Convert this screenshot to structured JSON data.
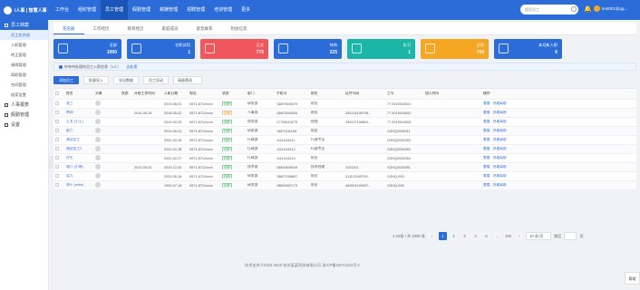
{
  "topbar": {
    "logo_text": "i人事 | 智慧人事",
    "nav": [
      {
        "label": "工作台"
      },
      {
        "label": "组织管理"
      },
      {
        "label": "员工管理"
      },
      {
        "label": "假勤管理"
      },
      {
        "label": "薪酬管理"
      },
      {
        "label": "招聘管理"
      },
      {
        "label": "培训管理"
      },
      {
        "label": "更多"
      }
    ],
    "active_nav": 2,
    "search_placeholder": "搜索员工",
    "username": "test001@qq..."
  },
  "sidebar": {
    "groups": [
      {
        "label": "员工档案",
        "active": true,
        "items": [
          {
            "label": "员工花名册",
            "active": true
          },
          {
            "label": "入职管理"
          },
          {
            "label": "转正管理"
          },
          {
            "label": "调岗管理"
          },
          {
            "label": "离职管理"
          },
          {
            "label": "合同管理"
          },
          {
            "label": "档案设置"
          }
        ]
      },
      {
        "label": "人事报表"
      },
      {
        "label": "假勤管理"
      },
      {
        "label": "设置"
      }
    ]
  },
  "tabs": [
    "花名册",
    "工作经历",
    "教育经历",
    "家庭成员",
    "紧急联系",
    "附加信息"
  ],
  "cards": [
    {
      "label": "全部",
      "value": "1000",
      "color": "#2b6cd8"
    },
    {
      "label": "在职试用",
      "value": "1",
      "color": "#2b6cd8"
    },
    {
      "label": "正式",
      "value": "775",
      "color": "#f0565c"
    },
    {
      "label": "待岗",
      "value": "225",
      "color": "#2b6cd8"
    },
    {
      "label": "实习",
      "value": "1",
      "color": "#1cb6a8"
    },
    {
      "label": "全职",
      "value": "709",
      "color": "#f5a623"
    },
    {
      "label": "本月新入职",
      "value": "6",
      "color": "#2b6cd8"
    }
  ],
  "notice": {
    "text": "你有待处理的员工入职信息（1人）",
    "link": "去处理"
  },
  "toolbar": {
    "add": "添加员工",
    "import": "批量导入",
    "export": "导出数据",
    "org": "员工异动",
    "filter": "高级筛选"
  },
  "table": {
    "headers": [
      "",
      "姓名",
      "头像",
      "状态",
      "开始工作时间",
      "入职日期",
      "电话",
      "状态",
      "部门",
      "手机号",
      "职位",
      "证件号码",
      "工号",
      "加入时间",
      "",
      "操作"
    ],
    "rows": [
      {
        "name": "张三",
        "start": "",
        "join": "2019-06-01",
        "phone": "0571-8712xxxx",
        "status": "在职",
        "dept": "研发部",
        "mobile": "15807649079",
        "post": "职员",
        "idno": "",
        "empno": "77 2019010001",
        "time": ""
      },
      {
        "name": "李四",
        "start": "2014-05-25",
        "join": "2018-05-22",
        "phone": "0571-8712xxxx",
        "status": "试用",
        "dept": "人事部",
        "mobile": "15807649034",
        "post": "职员",
        "idno": "330224199706...",
        "empno": "77 2019010002",
        "time": ""
      },
      {
        "name": "王五 (小王)",
        "start": "",
        "join": "2019-02-23",
        "phone": "0571-8712xxxx",
        "status": "在职",
        "dept": "财务部",
        "mobile": "17765410279",
        "post": "经理",
        "idno": "330227199601...",
        "empno": "77 2019010003",
        "time": ""
      },
      {
        "name": "赵六",
        "start": "",
        "join": "2019-06-01",
        "phone": "0571-8712xxxx",
        "status": "在职",
        "dept": "研发部",
        "mobile": "15871111159",
        "post": "职员",
        "idno": "",
        "empno": "GZHQ2020011",
        "time": ""
      },
      {
        "name": "测试员工",
        "start": "",
        "join": "2020-02-28",
        "phone": "0571-8712xxxx",
        "status": "在职",
        "dept": "行政部",
        "mobile": "11111111111",
        "post": "行政专员",
        "idno": "",
        "empno": "GZHQ2020083",
        "time": ""
      },
      {
        "name": "测试员工2",
        "start": "",
        "join": "2020-02-28",
        "phone": "0571-8712xxxx",
        "status": "在职",
        "dept": "行政部",
        "mobile": "11111111112",
        "post": "行政专员",
        "idno": "",
        "empno": "GZHQ2020080",
        "time": ""
      },
      {
        "name": "孙七",
        "start": "",
        "join": "2020-02-27",
        "phone": "0571-8712xxxx",
        "status": "在职",
        "dept": "行政部",
        "mobile": "11111111113",
        "post": "职员",
        "idno": "",
        "empno": "GZHQ2020084",
        "time": ""
      },
      {
        "name": "周八 (小周)",
        "start": "2010-05-02",
        "join": "2019-12-02",
        "phone": "0571-8712xxxx",
        "status": "在职",
        "dept": "技术部",
        "mobile": "15800649019",
        "post": "技术经理",
        "idno": "3101101",
        "empno": "GZHQ2020081",
        "time": ""
      },
      {
        "name": "吴九",
        "start": "",
        "join": "2020-06-18",
        "phone": "0571-8712xxxx",
        "status": "在职",
        "dept": "研发部",
        "mobile": "15807168697",
        "post": "职员",
        "idno": "411121199703...",
        "empno": "GZHQ-009",
        "time": ""
      },
      {
        "name": "郑十 (mike)",
        "start": "",
        "join": "1990-07-18",
        "phone": "0571-8712xxxx",
        "status": "在职",
        "dept": "研发部",
        "mobile": "15801697173",
        "post": "职员",
        "idno": "440801199007...",
        "empno": "GZHQ-008",
        "time": ""
      }
    ],
    "ops": [
      "查看",
      "办理离职"
    ]
  },
  "pager": {
    "summary": "1-10条 / 共 1000 条",
    "pages": [
      "1",
      "2",
      "3",
      "4",
      "5",
      "...",
      "100"
    ],
    "per_page": "10 条/页",
    "goto": "跳至",
    "unit": "页"
  },
  "footer": "技术支持 ©2015-2020 杭州某某科技有限公司 浙ICP备15071234号-1",
  "help": "帮助"
}
